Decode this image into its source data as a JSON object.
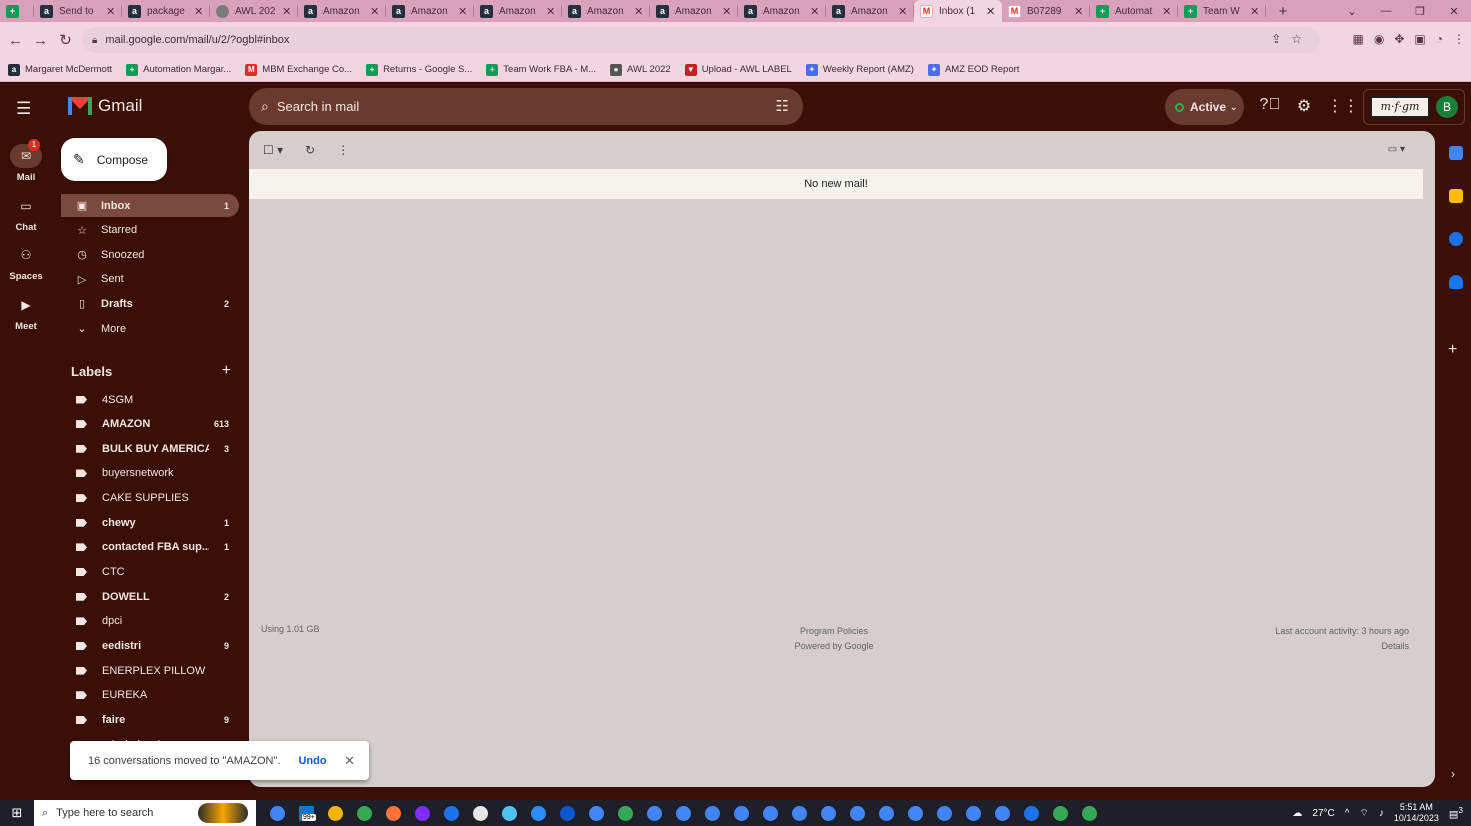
{
  "browser": {
    "tabs": [
      {
        "label": "",
        "icon": "sheets"
      },
      {
        "label": "Send to",
        "icon": "amazon"
      },
      {
        "label": "package",
        "icon": "amazon"
      },
      {
        "label": "AWL 202",
        "icon": "globe"
      },
      {
        "label": "Amazon",
        "icon": "amazon"
      },
      {
        "label": "Amazon",
        "icon": "amazon"
      },
      {
        "label": "Amazon",
        "icon": "amazon"
      },
      {
        "label": "Amazon",
        "icon": "amazon"
      },
      {
        "label": "Amazon",
        "icon": "amazon"
      },
      {
        "label": "Amazon",
        "icon": "amazon"
      },
      {
        "label": "Amazon",
        "icon": "amazon"
      },
      {
        "label": "Inbox (1",
        "icon": "gmail",
        "active": true
      },
      {
        "label": "B07289",
        "icon": "gmail"
      },
      {
        "label": "Automat",
        "icon": "sheets"
      },
      {
        "label": "Team W",
        "icon": "sheets"
      }
    ],
    "url": "mail.google.com/mail/u/2/?ogbl#inbox",
    "bookmarks": [
      {
        "label": "Margaret McDermott",
        "icon": "amazon"
      },
      {
        "label": "Automation Margar...",
        "icon": "sheets"
      },
      {
        "label": "MBM Exchange Co...",
        "icon": "gmail"
      },
      {
        "label": "Returns - Google S...",
        "icon": "sheets"
      },
      {
        "label": "Team Work FBA - M...",
        "icon": "sheets"
      },
      {
        "label": "AWL 2022",
        "icon": "globe"
      },
      {
        "label": "Upload - AWL LABEL",
        "icon": "arrow"
      },
      {
        "label": "Weekly Report (AMZ)",
        "icon": "tool"
      },
      {
        "label": "AMZ EOD Report",
        "icon": "tool"
      }
    ]
  },
  "gmail": {
    "brand": "Gmail",
    "search_placeholder": "Search in mail",
    "status": "Active",
    "avatar_letter": "B",
    "signature_text": "m·f·gm",
    "rail": [
      {
        "label": "Mail",
        "badge": "1"
      },
      {
        "label": "Chat"
      },
      {
        "label": "Spaces"
      },
      {
        "label": "Meet"
      }
    ],
    "compose_label": "Compose",
    "folders": [
      {
        "label": "Inbox",
        "count": "1",
        "icon": "inbox-icon",
        "glyph": "▣",
        "selected": true
      },
      {
        "label": "Starred",
        "count": "",
        "icon": "star-icon",
        "glyph": "☆"
      },
      {
        "label": "Snoozed",
        "count": "",
        "icon": "clock-icon",
        "glyph": "◷"
      },
      {
        "label": "Sent",
        "count": "",
        "icon": "send-icon",
        "glyph": "▷"
      },
      {
        "label": "Drafts",
        "count": "2",
        "icon": "draft-icon",
        "glyph": "▯",
        "bold": true
      },
      {
        "label": "More",
        "count": "",
        "icon": "chevron-down-icon",
        "glyph": "⌄"
      }
    ],
    "labels_heading": "Labels",
    "labels": [
      {
        "label": "4SGM",
        "count": ""
      },
      {
        "label": "AMAZON",
        "count": "613",
        "bold": true
      },
      {
        "label": "BULK BUY AMERICA",
        "count": "3",
        "bold": true
      },
      {
        "label": "buyersnetwork",
        "count": ""
      },
      {
        "label": "CAKE SUPPLIES",
        "count": ""
      },
      {
        "label": "chewy",
        "count": "1",
        "bold": true
      },
      {
        "label": "contacted FBA sup...",
        "count": "1",
        "bold": true
      },
      {
        "label": "CTC",
        "count": ""
      },
      {
        "label": "DOWELL",
        "count": "2",
        "bold": true
      },
      {
        "label": "dpci",
        "count": ""
      },
      {
        "label": "eedistri",
        "count": "9",
        "bold": true
      },
      {
        "label": "ENERPLEX PILLOW",
        "count": ""
      },
      {
        "label": "EUREKA",
        "count": ""
      },
      {
        "label": "faire",
        "count": "9",
        "bold": true
      },
      {
        "label": "gd wholesale",
        "count": ""
      }
    ],
    "empty_message": "No new mail!",
    "footer": {
      "storage": "Using 1.01 GB",
      "policies": "Program Policies",
      "powered": "Powered by Google",
      "activity": "Last account activity: 3 hours ago",
      "details": "Details"
    },
    "toast": {
      "message": "16 conversations moved to \"AMAZON\".",
      "undo": "Undo"
    }
  },
  "taskbar": {
    "search_placeholder": "Type here to search",
    "temperature": "27°C",
    "time": "5:51 AM",
    "date": "10/14/2023",
    "notification_count": "3",
    "mail_badge": "99+"
  },
  "colors": {
    "gmail_bg": "#3a0f05",
    "panel_bg": "#d6cecc",
    "chrome_tab": "#d9a0b9",
    "chrome_toolbar": "#f3d5e2"
  }
}
